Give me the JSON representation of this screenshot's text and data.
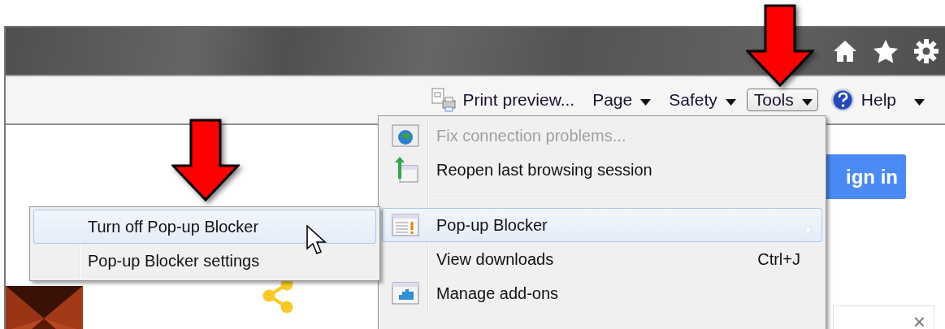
{
  "command_bar": [
    {
      "label": "Print preview...",
      "kind": "icon-label",
      "menu": false,
      "selected": false
    },
    {
      "label": "Page",
      "kind": "label",
      "menu": true,
      "selected": false
    },
    {
      "label": "Safety",
      "kind": "label",
      "menu": true,
      "selected": false
    },
    {
      "label": "Tools",
      "kind": "label",
      "menu": true,
      "selected": true
    },
    {
      "label": "Help",
      "kind": "help",
      "menu": true,
      "selected": false
    }
  ],
  "page": {
    "sign_in_button": "ign in",
    "close_glyph": "×"
  },
  "tools_menu": [
    {
      "kind": "item",
      "label": "Fix connection problems...",
      "disabled": true,
      "selected": false
    },
    {
      "kind": "item",
      "label": "Reopen last browsing session",
      "disabled": false,
      "selected": false
    },
    {
      "kind": "separator"
    },
    {
      "kind": "item",
      "label": "Pop-up Blocker",
      "disabled": false,
      "selected": true,
      "submenu": true
    },
    {
      "kind": "item",
      "label": "View downloads",
      "shortcut": "Ctrl+J",
      "disabled": false,
      "selected": false
    },
    {
      "kind": "item",
      "label": "Manage add-ons",
      "disabled": false,
      "selected": false
    }
  ],
  "popup_submenu": [
    {
      "kind": "item",
      "label": "Turn off Pop-up Blocker",
      "disabled": false,
      "selected": true
    },
    {
      "kind": "item",
      "label": "Pop-up Blocker settings",
      "disabled": false,
      "selected": false
    }
  ]
}
